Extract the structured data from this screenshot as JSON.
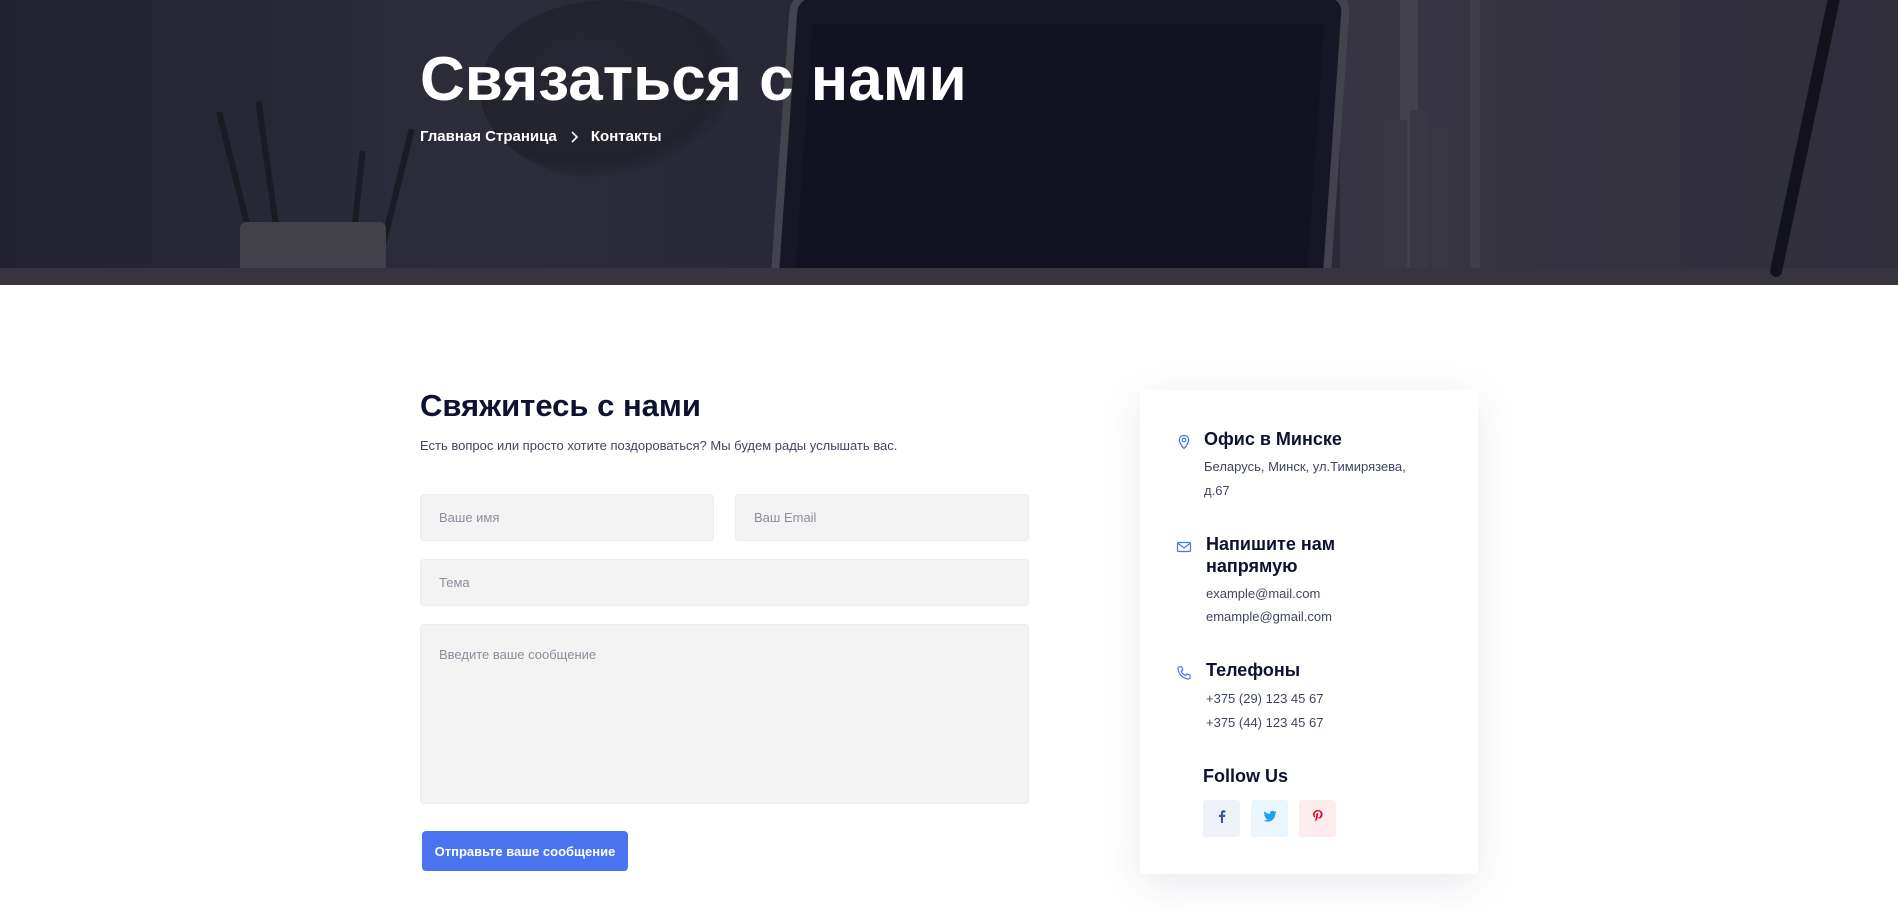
{
  "hero": {
    "title": "Связаться с нами",
    "breadcrumb": {
      "home": "Главная Страница",
      "current": "Контакты"
    }
  },
  "form": {
    "title": "Свяжитесь с нами",
    "subtitle": "Есть вопрос или просто хотите поздороваться? Мы будем рады услышать вас.",
    "name_placeholder": "Ваше имя",
    "email_placeholder": "Ваш Email",
    "subject_placeholder": "Тема",
    "message_placeholder": "Введите ваше сообщение",
    "submit_label": "Отправьте ваше сообщение"
  },
  "contact": {
    "office": {
      "title": "Офис в Минске",
      "lines": [
        "Беларусь, Минск, ул.Тимирязева,",
        "д.67"
      ]
    },
    "email": {
      "title_line1": "Напишите нам",
      "title_line2": "напрямую",
      "lines": [
        "example@mail.com",
        "emample@gmail.com"
      ]
    },
    "phones": {
      "title": "Телефоны",
      "lines": [
        "+375 (29) 123 45 67",
        "+375 (44) 123 45 67"
      ]
    },
    "follow": {
      "title": "Follow Us"
    }
  },
  "icons": {
    "location": "location-pin-icon",
    "email": "envelope-icon",
    "phone": "phone-icon",
    "facebook": "facebook-icon",
    "twitter": "twitter-icon",
    "pinterest": "pinterest-icon",
    "breadcrumb_sep": "chevron-right-icon"
  },
  "colors": {
    "accent": "#4a73f0",
    "heading": "#0d1230",
    "text": "#404660",
    "field_bg": "#f3f3f3",
    "facebook": "#3b5998",
    "twitter": "#1da1f2",
    "pinterest": "#e60023"
  }
}
